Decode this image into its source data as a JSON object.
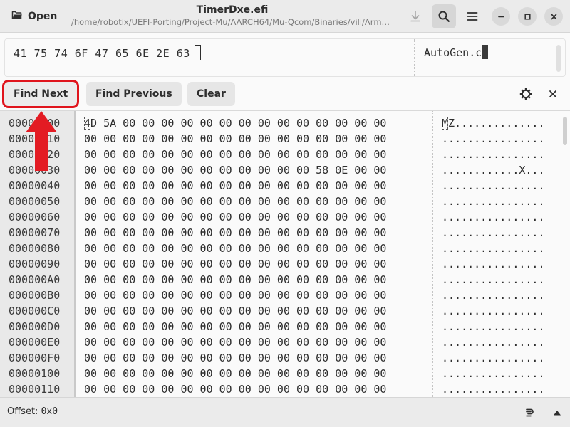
{
  "header": {
    "open_label": "Open",
    "title": "TimerDxe.efi",
    "subtitle": "/home/robotix/UEFI-Porting/Project-Mu/AARCH64/Mu-Qcom/Binaries/vili/ArmP…",
    "icons": [
      "download-icon",
      "search-icon",
      "hamburger-menu-icon",
      "minimize-icon",
      "maximize-icon",
      "close-icon"
    ]
  },
  "search": {
    "hex_query": "41 75 74 6F 47 65 6E 2E 63",
    "text_query": "AutoGen.c"
  },
  "actions": {
    "find_next": "Find Next",
    "find_previous": "Find Previous",
    "clear": "Clear"
  },
  "hex": {
    "rows": [
      {
        "offset": "00000000",
        "hex": "4D 5A 00 00 00 00 00 00 00 00 00 00 00 00 00 00",
        "ascii": "MZ.............."
      },
      {
        "offset": "00000010",
        "hex": "00 00 00 00 00 00 00 00 00 00 00 00 00 00 00 00",
        "ascii": "................"
      },
      {
        "offset": "00000020",
        "hex": "00 00 00 00 00 00 00 00 00 00 00 00 00 00 00 00",
        "ascii": "................"
      },
      {
        "offset": "00000030",
        "hex": "00 00 00 00 00 00 00 00 00 00 00 00 58 0E 00 00",
        "ascii": "............X..."
      },
      {
        "offset": "00000040",
        "hex": "00 00 00 00 00 00 00 00 00 00 00 00 00 00 00 00",
        "ascii": "................"
      },
      {
        "offset": "00000050",
        "hex": "00 00 00 00 00 00 00 00 00 00 00 00 00 00 00 00",
        "ascii": "................"
      },
      {
        "offset": "00000060",
        "hex": "00 00 00 00 00 00 00 00 00 00 00 00 00 00 00 00",
        "ascii": "................"
      },
      {
        "offset": "00000070",
        "hex": "00 00 00 00 00 00 00 00 00 00 00 00 00 00 00 00",
        "ascii": "................"
      },
      {
        "offset": "00000080",
        "hex": "00 00 00 00 00 00 00 00 00 00 00 00 00 00 00 00",
        "ascii": "................"
      },
      {
        "offset": "00000090",
        "hex": "00 00 00 00 00 00 00 00 00 00 00 00 00 00 00 00",
        "ascii": "................"
      },
      {
        "offset": "000000A0",
        "hex": "00 00 00 00 00 00 00 00 00 00 00 00 00 00 00 00",
        "ascii": "................"
      },
      {
        "offset": "000000B0",
        "hex": "00 00 00 00 00 00 00 00 00 00 00 00 00 00 00 00",
        "ascii": "................"
      },
      {
        "offset": "000000C0",
        "hex": "00 00 00 00 00 00 00 00 00 00 00 00 00 00 00 00",
        "ascii": "................"
      },
      {
        "offset": "000000D0",
        "hex": "00 00 00 00 00 00 00 00 00 00 00 00 00 00 00 00",
        "ascii": "................"
      },
      {
        "offset": "000000E0",
        "hex": "00 00 00 00 00 00 00 00 00 00 00 00 00 00 00 00",
        "ascii": "................"
      },
      {
        "offset": "000000F0",
        "hex": "00 00 00 00 00 00 00 00 00 00 00 00 00 00 00 00",
        "ascii": "................"
      },
      {
        "offset": "00000100",
        "hex": "00 00 00 00 00 00 00 00 00 00 00 00 00 00 00 00",
        "ascii": "................"
      },
      {
        "offset": "00000110",
        "hex": "00 00 00 00 00 00 00 00 00 00 00 00 00 00 00 00",
        "ascii": "................"
      }
    ]
  },
  "status": {
    "offset_label": "Offset:",
    "offset_value": "0x0",
    "icons": [
      "endianness-icon",
      "chevron-up-icon"
    ]
  },
  "colors": {
    "highlight": "#e0151d",
    "arrow": "#e31b23"
  }
}
